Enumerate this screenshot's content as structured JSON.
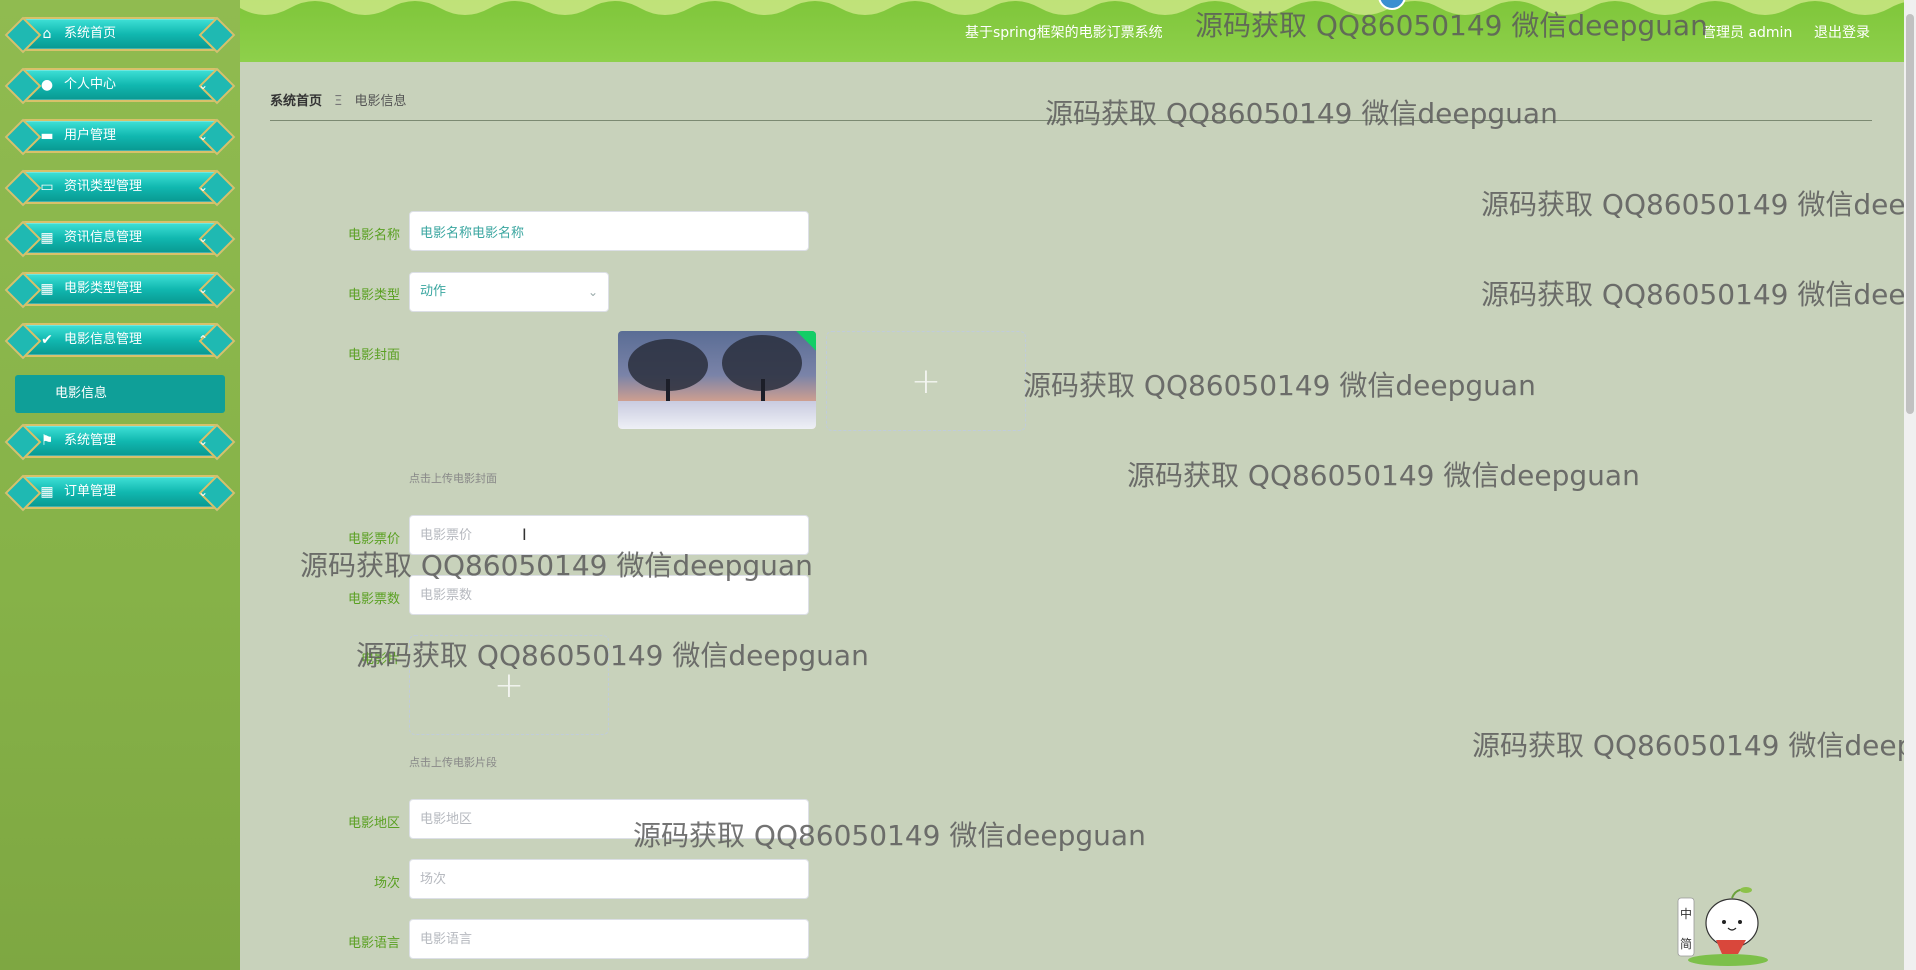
{
  "header": {
    "title": "基于spring框架的电影订票系统",
    "user": "管理员 admin",
    "logout": "退出登录"
  },
  "sidebar": {
    "items": [
      {
        "label": "系统首页",
        "icon": "home-icon",
        "arrow": ""
      },
      {
        "label": "个人中心",
        "icon": "user-icon",
        "arrow": "⌄"
      },
      {
        "label": "用户管理",
        "icon": "briefcase-icon",
        "arrow": "⌄"
      },
      {
        "label": "资讯类型管理",
        "icon": "monitor-icon",
        "arrow": "⌄"
      },
      {
        "label": "资讯信息管理",
        "icon": "grid-icon",
        "arrow": "⌄"
      },
      {
        "label": "电影类型管理",
        "icon": "grid-icon",
        "arrow": "⌄"
      },
      {
        "label": "电影信息管理",
        "icon": "clipboard-icon",
        "arrow": "⌃"
      },
      {
        "label": "系统管理",
        "icon": "flag-icon",
        "arrow": "⌄"
      },
      {
        "label": "订单管理",
        "icon": "grid-icon",
        "arrow": "⌄"
      }
    ],
    "sub_item": "电影信息"
  },
  "breadcrumb": {
    "home": "系统首页",
    "separator": "Ξ",
    "current": "电影信息"
  },
  "form": {
    "name_label": "电影名称",
    "name_value": "电影名称电影名称",
    "type_label": "电影类型",
    "type_value": "动作",
    "cover_label": "电影封面",
    "cover_hint": "点击上传电影封面",
    "price_label": "电影票价",
    "price_placeholder": "电影票价",
    "count_label": "电影票数",
    "count_placeholder": "电影票数",
    "clip_label": "电影片",
    "clip_hint": "点击上传电影片段",
    "region_label": "电影地区",
    "region_placeholder": "电影地区",
    "session_label": "场次",
    "session_placeholder": "场次",
    "language_label": "电影语言",
    "language_placeholder": "电影语言",
    "plus": "+"
  },
  "watermark": "源码获取 QQ86050149 微信deepguan",
  "mascot": {
    "line1": "中",
    "line2": "简"
  }
}
